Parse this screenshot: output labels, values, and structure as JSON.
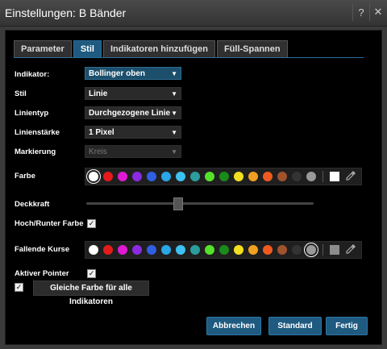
{
  "window": {
    "title": "Einstellungen: B Bänder",
    "help_icon": "?",
    "close_icon": "✕"
  },
  "tabs": [
    {
      "label": "Parameter",
      "active": false
    },
    {
      "label": "Stil",
      "active": true
    },
    {
      "label": "Indikatoren hinzufügen",
      "active": false
    },
    {
      "label": "Füll-Spannen",
      "active": false
    }
  ],
  "form": {
    "indikator": {
      "label": "Indikator:",
      "value": "Bollinger oben"
    },
    "stil": {
      "label": "Stil",
      "value": "Linie"
    },
    "linientyp": {
      "label": "Linientyp",
      "value": "Durchgezogene Linie"
    },
    "linienstaerke": {
      "label": "Linienstärke",
      "value": "1 Pixel"
    },
    "markierung": {
      "label": "Markierung",
      "value": "Kreis"
    },
    "farbe": {
      "label": "Farbe"
    },
    "deckkraft": {
      "label": "Deckkraft",
      "level_percent": 40
    },
    "hochrunter": {
      "label": "Hoch/Runter Farbe",
      "checked": true
    },
    "fallende": {
      "label": "Fallende Kurse"
    },
    "aktiver_pointer": {
      "label": "Aktiver Pointer",
      "checked": true
    },
    "gleiche_farbe": {
      "label": "Gleiche Farbe für alle Indikatoren",
      "checked": true
    }
  },
  "palette": [
    "#ffffff",
    "#e31b1b",
    "#e01ad3",
    "#8a2be2",
    "#2f5fe3",
    "#2aa7e8",
    "#3dc1f0",
    "#2c9c9c",
    "#55e22a",
    "#1a8a1a",
    "#f0e020",
    "#f0a020",
    "#f05a20",
    "#a0522d",
    "#333333",
    "#999999"
  ],
  "buttons": {
    "abbrechen": "Abbrechen",
    "standard": "Standard",
    "fertig": "Fertig"
  }
}
